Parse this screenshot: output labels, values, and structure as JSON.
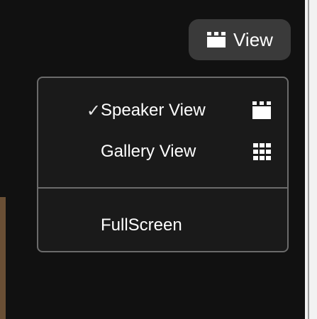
{
  "toolbar": {
    "view_label": "View",
    "view_icon": "speaker-view-icon"
  },
  "view_menu": {
    "items": [
      {
        "label": "Speaker View",
        "checked": true,
        "check_mark": "✓",
        "icon": "speaker-view-icon"
      },
      {
        "label": "Gallery View",
        "checked": false,
        "icon": "gallery-view-icon"
      }
    ],
    "fullscreen_label": "FullScreen"
  },
  "colors": {
    "background": "#111111",
    "button_bg": "#3a3a3a",
    "menu_border": "#6b6b6b",
    "text": "#ffffff"
  }
}
